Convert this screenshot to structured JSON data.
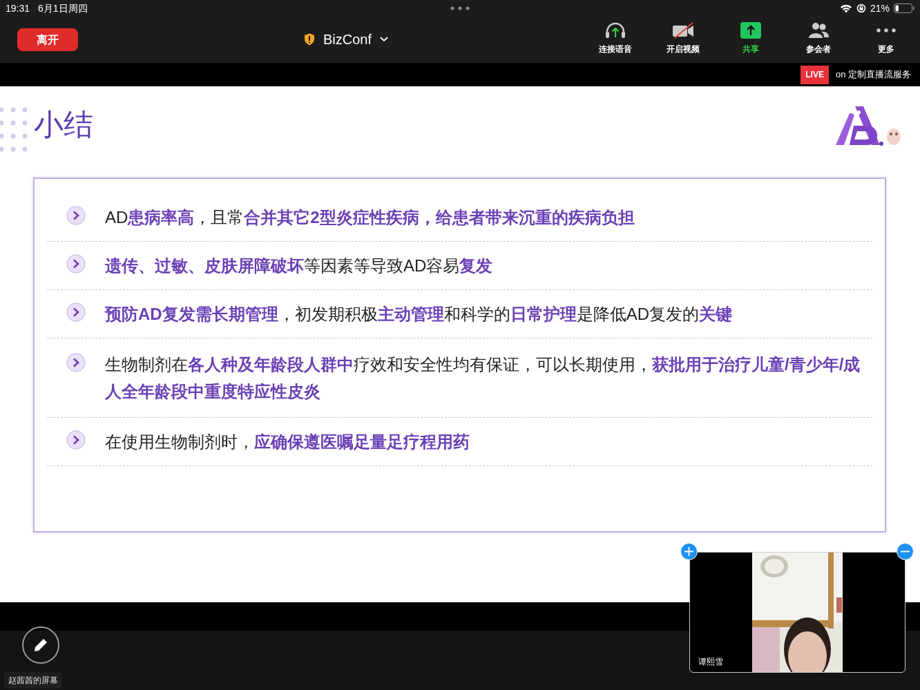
{
  "status_bar": {
    "time": "19:31",
    "date": "6月1日周四",
    "battery": "21%"
  },
  "toolbar": {
    "leave_button": "离开",
    "meeting_title": "BizConf",
    "items": [
      {
        "kind": "audio",
        "label": "连接语音"
      },
      {
        "kind": "video",
        "label": "开启视频"
      },
      {
        "kind": "share",
        "label": "共享"
      },
      {
        "kind": "participants",
        "label": "参会者"
      },
      {
        "kind": "more",
        "label": "更多"
      }
    ]
  },
  "live_banner": {
    "badge": "LIVE",
    "text": "on 定制直播流服务"
  },
  "slide": {
    "title": "小结",
    "bullets": [
      "AD**患病率高**，且常**合并其它2型炎症性疾病，给患者带来沉重的疾病负担**",
      "**遗传、过敏、皮肤屏障破坏**等因素等导致AD容易**复发**",
      "**预防AD复发需长期管理**，初发期积极**主动管理**和科学的**日常护理**是降低AD复发的**关键**",
      "生物制剂在**各人种及年龄段人群中**疗效和安全性均有保证，可以长期使用，**获批用于治疗儿童/青少年/成人全年龄段中重度特应性皮炎**",
      "在使用生物制剂时，**应确保遵医嘱足量足疗程用药**"
    ]
  },
  "video_tile": {
    "name": "谭熙雪"
  },
  "screen_label": "赵茜茜的屏幕"
}
